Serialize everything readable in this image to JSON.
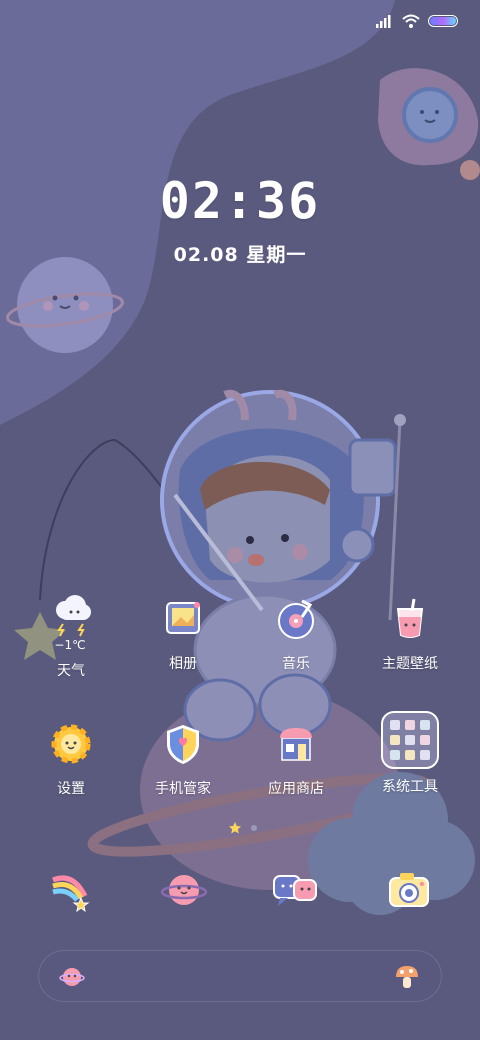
{
  "clock": {
    "time": "02:36",
    "date": "02.08 星期一"
  },
  "status_bar": {
    "icons": [
      "signal-icon",
      "wifi-icon",
      "battery-icon"
    ],
    "battery_level": 1.0,
    "battery_colors": [
      "#6a7dff",
      "#b46bff",
      "#5fd8ff"
    ]
  },
  "colors": {
    "background": "#5a5a7e",
    "sky_upper": "#6b6b9a",
    "planet": "#8f8fbf",
    "astronaut_outline": "#9aa8e6"
  },
  "apps_row1": [
    {
      "label": "天气",
      "icon": "weather-icon",
      "temperature": "−1℃"
    },
    {
      "label": "相册",
      "icon": "gallery-icon"
    },
    {
      "label": "音乐",
      "icon": "music-icon"
    },
    {
      "label": "主题壁纸",
      "icon": "theme-icon"
    }
  ],
  "apps_row2": [
    {
      "label": "设置",
      "icon": "settings-icon"
    },
    {
      "label": "手机管家",
      "icon": "security-icon"
    },
    {
      "label": "应用商店",
      "icon": "app-store-icon"
    },
    {
      "label": "系统工具",
      "icon": "system-tools-folder"
    }
  ],
  "page_indicator": {
    "current": 1,
    "total": 2
  },
  "dock": [
    "rainbow-icon",
    "planet-icon",
    "chat-icon",
    "camera-icon"
  ],
  "search_bar": {
    "left_icon": "planet-face-icon",
    "right_icon": "mushroom-icon"
  }
}
